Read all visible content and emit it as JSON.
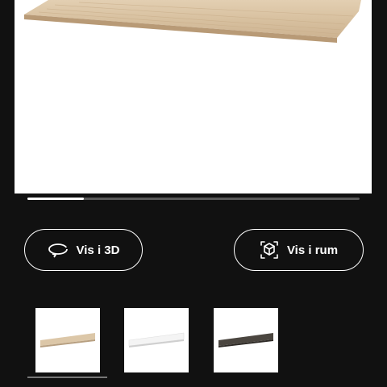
{
  "gallery": {
    "position_fraction": 0.17
  },
  "actions": {
    "view_3d_label": "Vis i 3D",
    "view_room_label": "Vis i rum"
  },
  "thumbnails": [
    {
      "name": "oak-effect",
      "color": "#dcc7a8"
    },
    {
      "name": "white",
      "color": "#f4f4f4"
    },
    {
      "name": "black-brown",
      "color": "#4b4640"
    }
  ],
  "icons": {
    "view_3d": "rotate-360-icon",
    "view_room": "ar-cube-icon"
  }
}
